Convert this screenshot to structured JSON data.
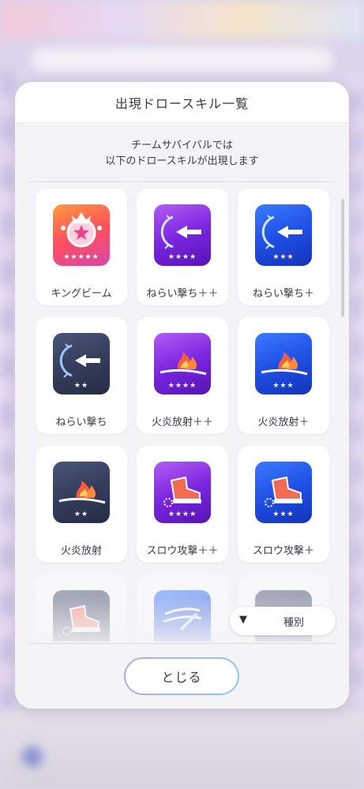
{
  "dialog": {
    "title": "出現ドロースキル一覧",
    "description_line1": "チームサバイバルでは",
    "description_line2": "以下のドロースキルが出現します"
  },
  "skills": [
    {
      "name": "キングビーム",
      "stars": "★★★★★",
      "icon": "king-beam-icon",
      "color": "#ff6a3a"
    },
    {
      "name": "ねらい撃ち＋＋",
      "stars": "★★★★",
      "icon": "aimed-shot-icon",
      "color": "#8a2be8"
    },
    {
      "name": "ねらい撃ち＋",
      "stars": "★★★",
      "icon": "aimed-shot-icon",
      "color": "#1f4fe6"
    },
    {
      "name": "ねらい撃ち",
      "stars": "★★",
      "icon": "aimed-shot-icon",
      "color": "#3b4466"
    },
    {
      "name": "火炎放射＋＋",
      "stars": "★★★★",
      "icon": "flamethrower-icon",
      "color": "#8a2be8"
    },
    {
      "name": "火炎放射＋",
      "stars": "★★★",
      "icon": "flamethrower-icon",
      "color": "#1f4fe6"
    },
    {
      "name": "火炎放射",
      "stars": "★★",
      "icon": "flamethrower-icon",
      "color": "#3b4466"
    },
    {
      "name": "スロウ攻撃＋＋",
      "stars": "★★★★",
      "icon": "slow-attack-icon",
      "color": "#8a2be8"
    },
    {
      "name": "スロウ攻撃＋",
      "stars": "★★★",
      "icon": "slow-attack-icon",
      "color": "#1f4fe6"
    },
    {
      "name": "",
      "stars": "★★",
      "icon": "slow-attack-icon",
      "color": "#3b4466"
    },
    {
      "name": "",
      "stars": "",
      "icon": "wind-slash-icon",
      "color": "#1f4fe6"
    },
    {
      "name": "",
      "stars": "",
      "icon": "wind-slash-icon",
      "color": "#3b4466"
    }
  ],
  "filter": {
    "sort_arrow": "▼",
    "sort_label": "種別"
  },
  "close_button": "とじる"
}
